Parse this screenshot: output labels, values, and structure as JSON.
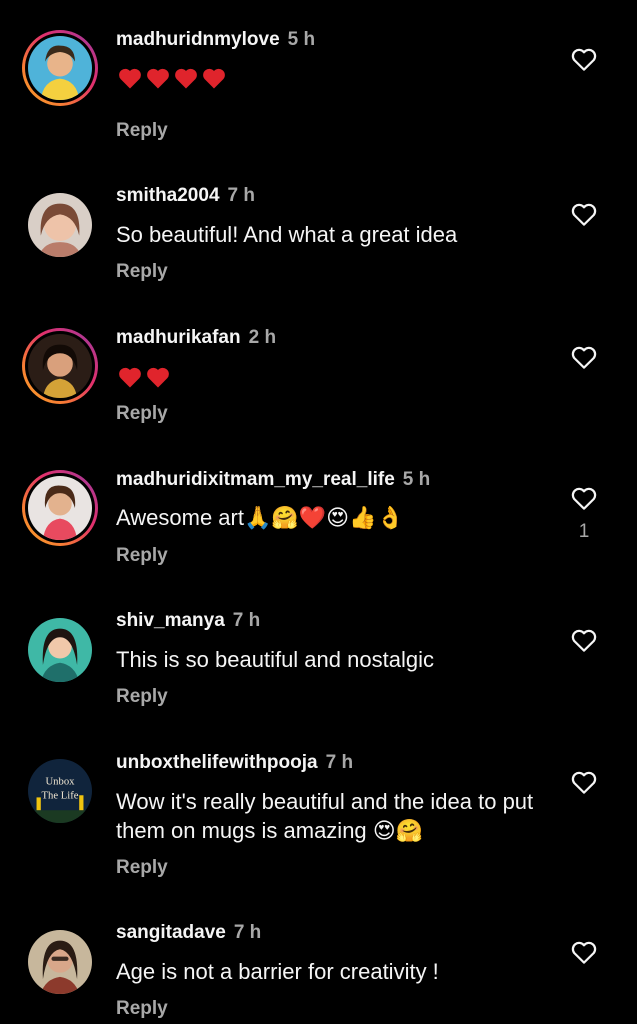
{
  "comments": [
    {
      "username": "madhuridnmylove",
      "time": "5 h",
      "text": "❤️❤️❤️❤️",
      "reply": "Reply",
      "like_count": ""
    },
    {
      "username": "smitha2004",
      "time": "7 h",
      "text": "So beautiful! And what a great idea",
      "reply": "Reply",
      "like_count": ""
    },
    {
      "username": "madhurikafan",
      "time": "2 h",
      "text": "❤️❤️",
      "reply": "Reply",
      "like_count": ""
    },
    {
      "username": "madhuridixitmam_my_real_life",
      "time": "5 h",
      "text": "Awesome art🙏🤗❤️😍👍👌",
      "reply": "Reply",
      "like_count": "1"
    },
    {
      "username": "shiv_manya",
      "time": "7 h",
      "text": "This is so beautiful and nostalgic",
      "reply": "Reply",
      "like_count": ""
    },
    {
      "username": "unboxthelifewithpooja",
      "time": "7 h",
      "text": "Wow it's really beautiful and the idea to put them on mugs is amazing 😍🤗",
      "reply": "Reply",
      "like_count": "",
      "avatar_text": [
        "Unbox",
        "The Life"
      ]
    },
    {
      "username": "sangitadave",
      "time": "7 h",
      "text": "Age is not a barrier for creativity !",
      "reply": "Reply",
      "like_count": ""
    }
  ],
  "colors": {
    "background": "#000000",
    "primary_text": "#f5f5f5",
    "secondary_text": "#a8a8a8",
    "heart": "#e0242c"
  },
  "icons": {
    "like": "heart-outline-icon"
  }
}
